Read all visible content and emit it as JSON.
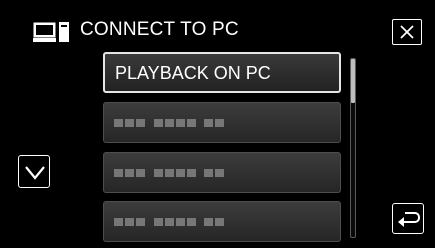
{
  "header": {
    "title": "CONNECT TO PC",
    "icon": "pc-connection-icon",
    "close_icon": "close-icon"
  },
  "menu": {
    "items": [
      {
        "label": "PLAYBACK ON PC",
        "selected": true
      },
      {
        "label": "",
        "placeholder": true
      },
      {
        "label": "",
        "placeholder": true
      },
      {
        "label": "",
        "placeholder": true
      }
    ]
  },
  "scrollbar": {
    "position": 0.0
  },
  "nav": {
    "scroll_down_icon": "chevron-down-icon",
    "back_icon": "return-arrow-icon"
  },
  "colors": {
    "background": "#000000",
    "text": "#ffffff",
    "item": "#333333"
  }
}
